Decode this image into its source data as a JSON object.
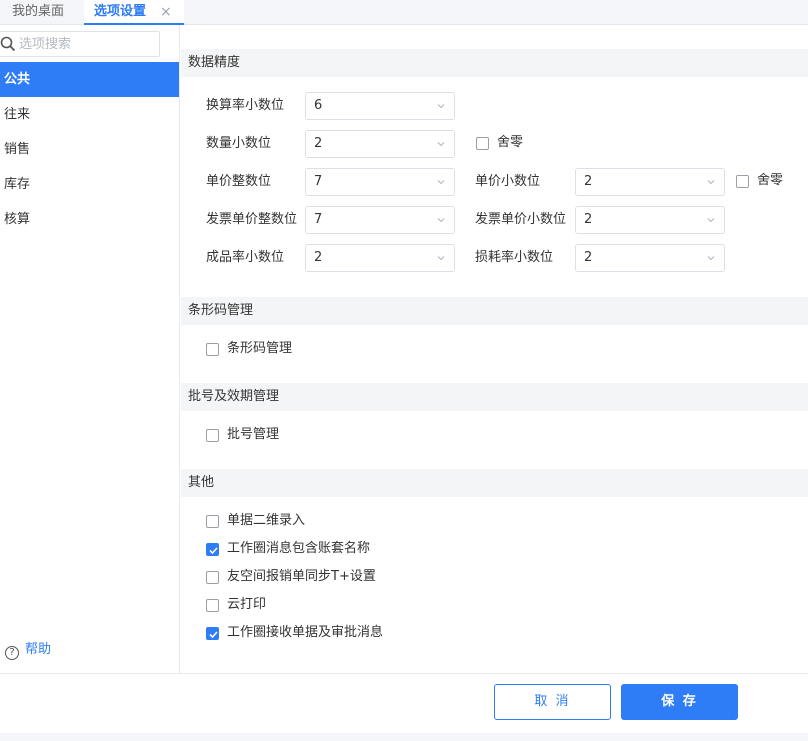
{
  "tabs": [
    {
      "label": "我的桌面"
    },
    {
      "label": "选项设置"
    }
  ],
  "icons": {
    "tab_close": "×",
    "help": "?"
  },
  "colors": {
    "accent": "#2f7df6",
    "section_bg": "#f4f5f7"
  },
  "sidebar": {
    "search_placeholder": "选项搜索",
    "items": [
      {
        "label": "公共"
      },
      {
        "label": "往来"
      },
      {
        "label": "销售"
      },
      {
        "label": "库存"
      },
      {
        "label": "核算"
      }
    ],
    "help_label": "帮助"
  },
  "sections": {
    "precision": {
      "title": "数据精度",
      "fields": {
        "conversion_decimals": {
          "label": "换算率小数位",
          "value": "6"
        },
        "quantity_decimals": {
          "label": "数量小数位",
          "value": "2"
        },
        "unit_price_integer": {
          "label": "单价整数位",
          "value": "7"
        },
        "unit_price_decimals": {
          "label": "单价小数位",
          "value": "2"
        },
        "invoice_price_integer": {
          "label": "发票单价整数位",
          "value": "7"
        },
        "invoice_price_decimals": {
          "label": "发票单价小数位",
          "value": "2"
        },
        "yield_decimals": {
          "label": "成品率小数位",
          "value": "2"
        },
        "loss_decimals": {
          "label": "损耗率小数位",
          "value": "2"
        }
      },
      "round_zero_label": "舍零"
    },
    "barcode": {
      "title": "条形码管理",
      "option_label": "条形码管理"
    },
    "batch": {
      "title": "批号及效期管理",
      "option_label": "批号管理"
    },
    "other": {
      "title": "其他",
      "options": [
        {
          "label": "单据二维录入",
          "checked": false
        },
        {
          "label": "工作圈消息包含账套名称",
          "checked": true
        },
        {
          "label": "友空间报销单同步T+设置",
          "checked": false
        },
        {
          "label": "云打印",
          "checked": false
        },
        {
          "label": "工作圈接收单据及审批消息",
          "checked": true
        }
      ]
    }
  },
  "footer": {
    "cancel_label": "取 消",
    "save_label": "保 存"
  }
}
